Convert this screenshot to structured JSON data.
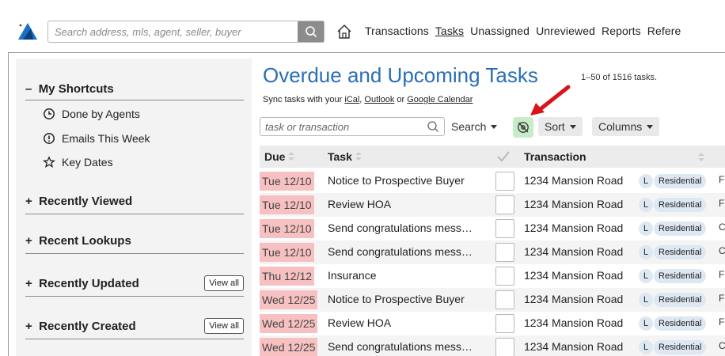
{
  "header": {
    "search_placeholder": "Search address, mls, agent, seller, buyer",
    "nav": [
      "Transactions",
      "Tasks",
      "Unassigned",
      "Unreviewed",
      "Reports",
      "Refere"
    ]
  },
  "sidebar": {
    "my_shortcuts": "My Shortcuts",
    "shortcuts": [
      {
        "label": "Done by Agents",
        "icon": "clock-icon"
      },
      {
        "label": "Emails This Week",
        "icon": "alert-circle-icon"
      },
      {
        "label": "Key Dates",
        "icon": "star-icon"
      }
    ],
    "recently_viewed": "Recently Viewed",
    "recent_lookups": "Recent Lookups",
    "recently_updated": "Recently Updated",
    "recently_created": "Recently Created",
    "view_all": "View all",
    "minus": "–",
    "plus": "+"
  },
  "main": {
    "title": "Overdue and Upcoming Tasks",
    "count": "1–50 of 1516 tasks.",
    "sync_prefix": "Sync tasks with your",
    "sync_ical": "iCal",
    "sync_outlook": "Outlook",
    "sync_or": "or",
    "sync_google": "Google Calendar",
    "filter_placeholder": "task or transaction",
    "search_btn": "Search",
    "sort_btn": "Sort",
    "columns_btn": "Columns"
  },
  "table": {
    "headers": {
      "due": "Due",
      "task": "Task",
      "transaction": "Transaction"
    },
    "rows": [
      {
        "due": "Tue 12/10",
        "task": "Notice to Prospective Buyer",
        "trans": "1234 Mansion Road",
        "tag1": "L",
        "tag2": "Residential",
        "trunc": "F"
      },
      {
        "due": "Tue 12/10",
        "task": "Review HOA",
        "trans": "1234 Mansion Road",
        "tag1": "L",
        "tag2": "Residential",
        "trunc": "F"
      },
      {
        "due": "Tue 12/10",
        "task": "Send congratulations mess…",
        "trans": "1234 Mansion Road",
        "tag1": "L",
        "tag2": "Residential",
        "trunc": "C"
      },
      {
        "due": "Tue 12/10",
        "task": "Send congratulations mess…",
        "trans": "1234 Mansion Road",
        "tag1": "L",
        "tag2": "Residential",
        "trunc": "C"
      },
      {
        "due": "Thu 12/12",
        "task": "Insurance",
        "trans": "1234 Mansion Road",
        "tag1": "L",
        "tag2": "Residential",
        "trunc": "F"
      },
      {
        "due": "Wed 12/25",
        "task": "Notice to Prospective Buyer",
        "trans": "1234 Mansion Road",
        "tag1": "L",
        "tag2": "Residential",
        "trunc": "F"
      },
      {
        "due": "Wed 12/25",
        "task": "Review HOA",
        "trans": "1234 Mansion Road",
        "tag1": "L",
        "tag2": "Residential",
        "trunc": "F"
      },
      {
        "due": "Wed 12/25",
        "task": "Send congratulations mess…",
        "trans": "1234 Mansion Road",
        "tag1": "L",
        "tag2": "Residential",
        "trunc": "C"
      }
    ]
  },
  "colors": {
    "accent": "#2a6fb5",
    "overdue": "#f8c1c1",
    "highlight": "#c9ecc8",
    "arrow": "#d8141b"
  }
}
